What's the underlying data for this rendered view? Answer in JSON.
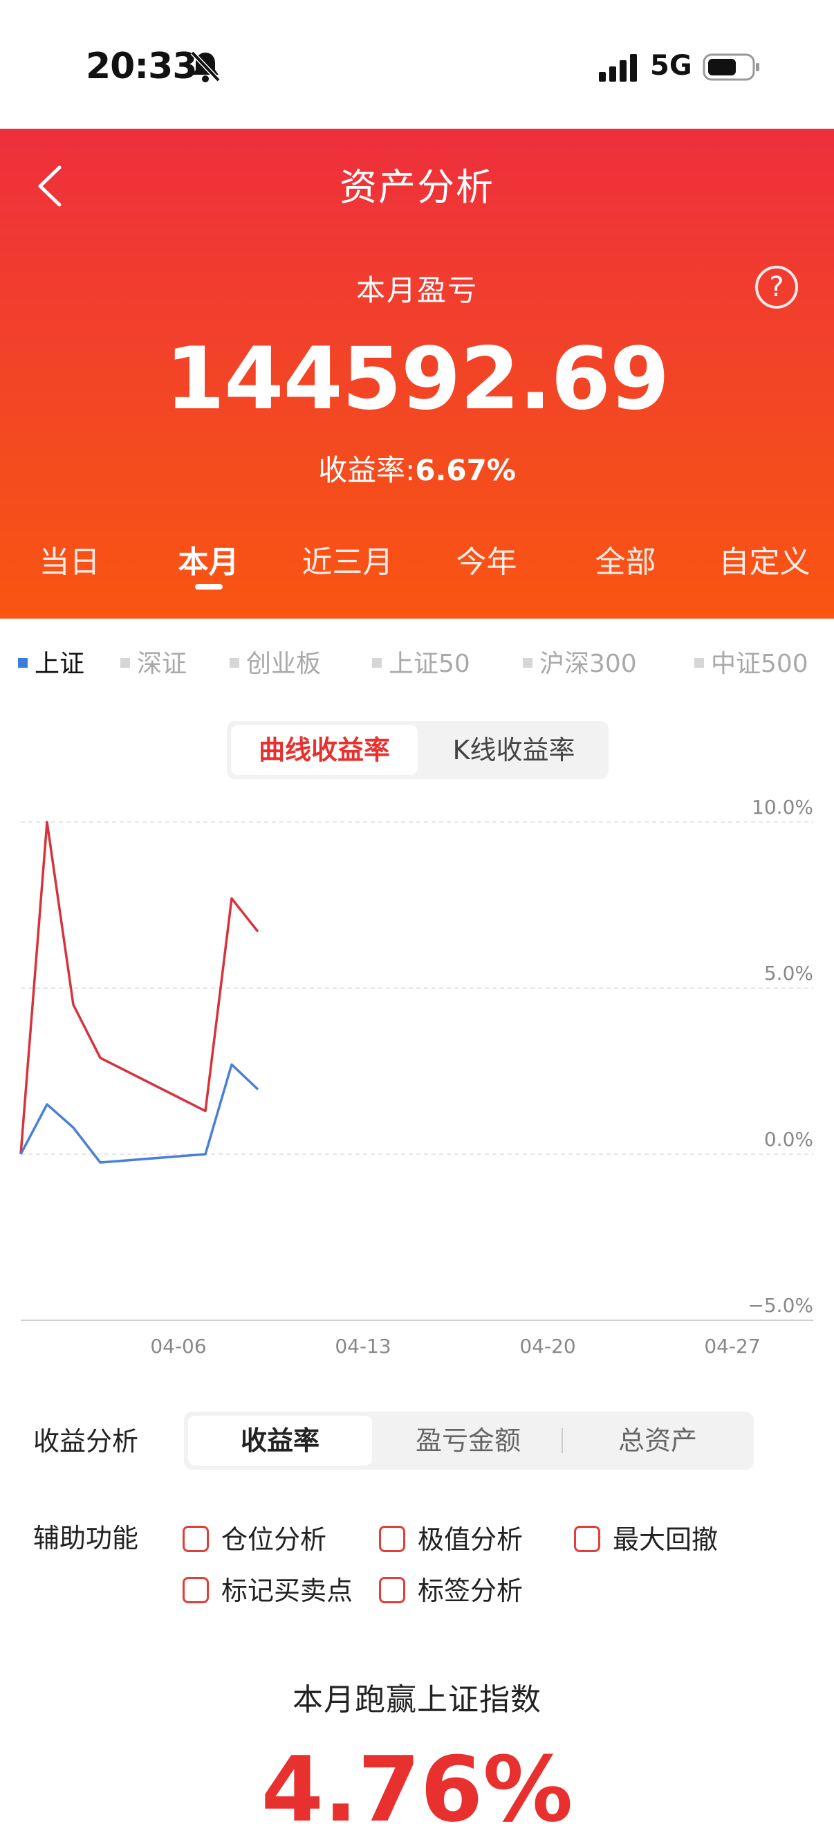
{
  "status_bar": {
    "time": "20:33",
    "network": "5G"
  },
  "header": {
    "title": "资产分析",
    "section_label": "本月盈亏",
    "help_glyph": "?",
    "amount": "144592.69",
    "rate_label": "收益率:",
    "rate_value": "6.67%"
  },
  "period_tabs": [
    "当日",
    "本月",
    "近三月",
    "今年",
    "全部",
    "自定义"
  ],
  "period_active": "本月",
  "index_tabs": [
    "上证",
    "深证",
    "创业板",
    "上证50",
    "沪深300",
    "中证500"
  ],
  "index_active": "上证",
  "chart_type_tabs": {
    "active": "曲线收益率",
    "other": "K线收益率"
  },
  "chart_data": {
    "type": "line",
    "y_ticks": [
      "10.0%",
      "5.0%",
      "0.0%",
      "−5.0%"
    ],
    "x_ticks": [
      "04-06",
      "04-13",
      "04-20",
      "04-27"
    ],
    "ylim": [
      -5,
      10
    ],
    "grid": true,
    "series": [
      {
        "color": "#d6333d",
        "points": [
          [
            1,
            0.0
          ],
          [
            2,
            10.0
          ],
          [
            3,
            4.5
          ],
          [
            4,
            2.9
          ],
          [
            8,
            1.3
          ],
          [
            9,
            7.7
          ],
          [
            10,
            6.7
          ]
        ]
      },
      {
        "color": "#4a7fd8",
        "points": [
          [
            1,
            0.0
          ],
          [
            2,
            1.5
          ],
          [
            3,
            0.8
          ],
          [
            4,
            -0.25
          ],
          [
            8,
            0.0
          ],
          [
            9,
            2.7
          ],
          [
            10,
            1.95
          ]
        ]
      }
    ],
    "x_domain": [
      1,
      31
    ]
  },
  "analysis": {
    "label": "收益分析",
    "tabs": [
      "收益率",
      "盈亏金额",
      "总资产"
    ],
    "active": "收益率"
  },
  "aux": {
    "label": "辅助功能",
    "options": [
      "仓位分析",
      "极值分析",
      "最大回撤",
      "标记买卖点",
      "标签分析"
    ]
  },
  "summary": {
    "title": "本月跑赢上证指数",
    "value": "4.76%"
  },
  "colors": {
    "brand_red": "#e8312f",
    "header_top": "#ee2f3d",
    "header_bottom": "#fa5512",
    "index_active": "#3c7be0"
  }
}
